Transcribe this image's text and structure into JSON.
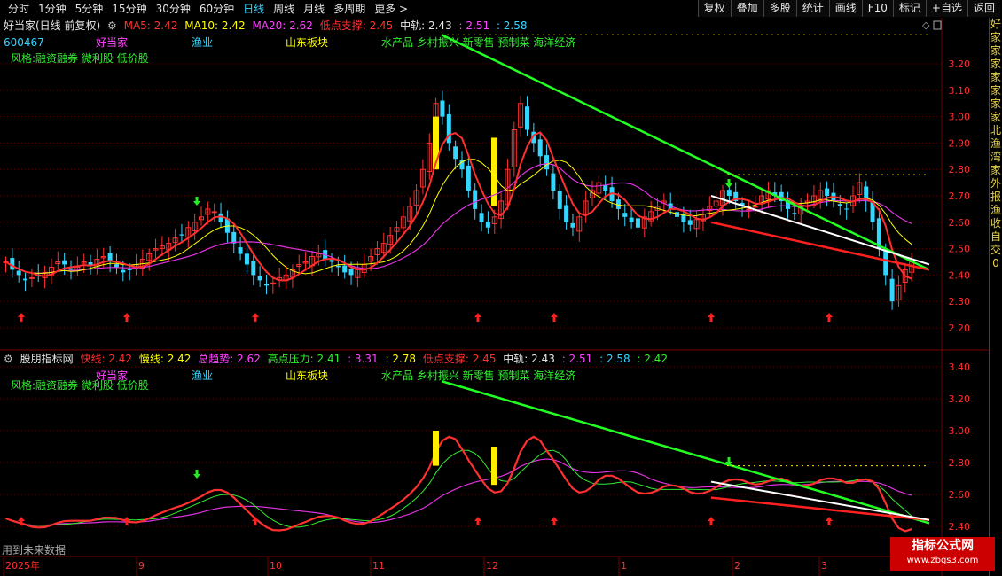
{
  "toolbar": {
    "period_tabs": [
      "分时",
      "1分钟",
      "5分钟",
      "15分钟",
      "30分钟",
      "60分钟",
      "日线",
      "周线",
      "月线",
      "多周期",
      "更多 >"
    ],
    "active_tab": "日线",
    "buttons": [
      "复权",
      "叠加",
      "多股",
      "统计",
      "画线",
      "F10",
      "标记",
      "+自选",
      "返回"
    ]
  },
  "upper_panel": {
    "stock_title": "好当家(日线 前复权)",
    "ma5": "MA5: 2.42",
    "ma10": "MA10: 2.42",
    "ma20": "MA20: 2.62",
    "low_support": "低点支撑: 2.45",
    "mid_track_label": "中轨: 2.43",
    "mid_track_v2": ": 2.51",
    "mid_track_v3": ": 2.58",
    "code": "600467",
    "name": "好当家",
    "industry": "渔业",
    "region": "山东板块",
    "concepts": "水产品 乡村振兴 新零售 预制菜 海洋经济",
    "style": "风格:融资融券 微利股 低价股",
    "price_ticks": [
      "3.20",
      "3.10",
      "3.00",
      "2.90",
      "2.80",
      "2.70",
      "2.60",
      "2.50",
      "2.40",
      "2.30",
      "2.20"
    ]
  },
  "lower_panel": {
    "indicator_title": "股朋指标网",
    "fast_line": "快线: 2.42",
    "slow_line": "慢线: 2.42",
    "total_trend": "总趋势: 2.62",
    "high_pressure": "高点压力: 2.41",
    "high_pressure_v2": ": 3.31",
    "high_pressure_v3": ": 2.78",
    "low_support": "低点支撑: 2.45",
    "mid_track_label": "中轨: 2.43",
    "mid_track_v2": ": 2.51",
    "mid_track_v3": ": 2.58",
    "mid_track_v4": ": 2.42",
    "name": "好当家",
    "industry": "渔业",
    "region": "山东板块",
    "concepts": "水产品 乡村振兴 新零售 预制菜 海洋经济",
    "style": "风格:融资融券 微利股 低价股",
    "price_ticks": [
      "3.40",
      "3.20",
      "3.00",
      "2.80",
      "2.60",
      "2.40"
    ],
    "future_note": "用到未来数据"
  },
  "time_axis": {
    "labels": [
      "2025年",
      "9",
      "10",
      "11",
      "12",
      "1",
      "2",
      "3"
    ]
  },
  "right_strip_text": [
    "好",
    "家",
    "家",
    "家",
    "家",
    "家",
    "家",
    "家",
    "北",
    "渔",
    "湾",
    "家",
    "外",
    "报",
    "渔",
    "收",
    "自",
    "交",
    "0"
  ],
  "watermark": {
    "title": "指标公式网",
    "url": "www.zbgs3.com"
  },
  "colors": {
    "up": "#ff3030",
    "down": "#33d6ff",
    "ma5": "#ffffff",
    "ma10": "#ffff00",
    "ma20": "#ff00ff",
    "trend_green": "#22ff22",
    "support_red": "#ff2020",
    "mid_white": "#ffffff",
    "grid": "#5a0000"
  }
}
